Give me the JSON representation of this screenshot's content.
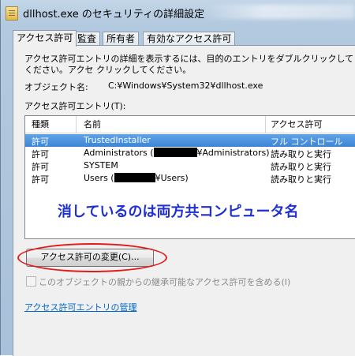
{
  "window": {
    "title": "dllhost.exe のセキュリティの詳細設定"
  },
  "tabs": [
    {
      "label": "アクセス許可",
      "active": true
    },
    {
      "label": "監査",
      "active": false
    },
    {
      "label": "所有者",
      "active": false
    },
    {
      "label": "有効なアクセス許可",
      "active": false
    }
  ],
  "panel": {
    "description": "アクセス許可エントリの詳細を表示するには、目的のエントリをダブルクリックしてください。アクセ クリックしてください。",
    "object_name_label": "オブジェクト名:",
    "object_name_value": "C:¥Windows¥System32¥dllhost.exe",
    "entries_label": "アクセス許可エントリ(T):"
  },
  "table": {
    "headers": [
      "種類",
      "名前",
      "アクセス許可"
    ],
    "rows": [
      {
        "type": "許可",
        "name": "TrustedInstaller",
        "permission": "フル コントロール",
        "selected": true
      },
      {
        "type": "許可",
        "name_prefix": "Administrators (",
        "name_suffix": "¥Administrators)",
        "permission": "読み取りと実行",
        "selected": false
      },
      {
        "type": "許可",
        "name": "SYSTEM",
        "permission": "読み取りと実行",
        "selected": false
      },
      {
        "type": "許可",
        "name_prefix": "Users (",
        "name_suffix": "¥Users)",
        "permission": "読み取りと実行",
        "selected": false
      }
    ]
  },
  "annotation": "消しているのは両方共コンピュータ名",
  "change_button": "アクセス許可の変更(C)...",
  "inherit_checkbox": {
    "label": "このオブジェクトの親からの継承可能なアクセス許可を含める(I)",
    "checked": false
  },
  "manage_link": "アクセス許可エントリの管理",
  "colors": {
    "selection": "#3d86d6",
    "annotation_text": "#1f2fd1",
    "highlight_ellipse": "#e21b1b",
    "link": "#0066cc"
  }
}
